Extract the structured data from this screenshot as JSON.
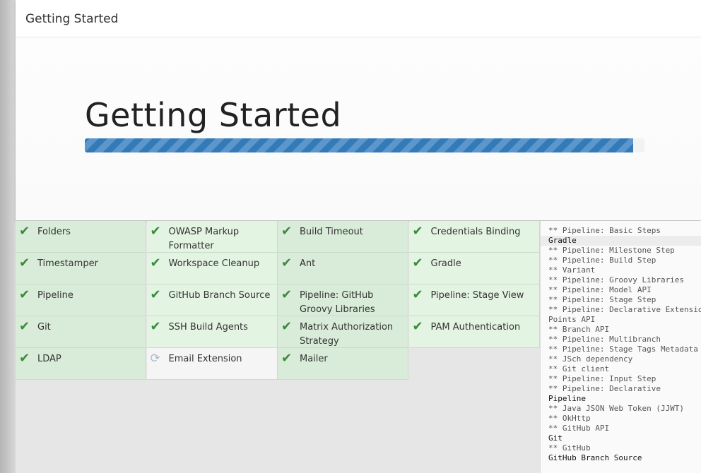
{
  "window": {
    "title": "Getting Started"
  },
  "hero": {
    "title": "Getting Started",
    "progress_percent": 98
  },
  "plugins": [
    {
      "label": "Folders",
      "status": "done"
    },
    {
      "label": "OWASP Markup Formatter",
      "status": "done"
    },
    {
      "label": "Build Timeout",
      "status": "done"
    },
    {
      "label": "Credentials Binding",
      "status": "done"
    },
    {
      "label": "Timestamper",
      "status": "done"
    },
    {
      "label": "Workspace Cleanup",
      "status": "done"
    },
    {
      "label": "Ant",
      "status": "done"
    },
    {
      "label": "Gradle",
      "status": "done"
    },
    {
      "label": "Pipeline",
      "status": "done"
    },
    {
      "label": "GitHub Branch Source",
      "status": "done"
    },
    {
      "label": "Pipeline: GitHub Groovy Libraries",
      "status": "done"
    },
    {
      "label": "Pipeline: Stage View",
      "status": "done"
    },
    {
      "label": "Git",
      "status": "done"
    },
    {
      "label": "SSH Build Agents",
      "status": "done"
    },
    {
      "label": "Matrix Authorization Strategy",
      "status": "done"
    },
    {
      "label": "PAM Authentication",
      "status": "done"
    },
    {
      "label": "LDAP",
      "status": "done"
    },
    {
      "label": "Email Extension",
      "status": "pending"
    },
    {
      "label": "Mailer",
      "status": "done"
    }
  ],
  "icons": {
    "done": "checkmark-icon",
    "pending": "spinner-icon"
  },
  "colors": {
    "accent": "#337ab7",
    "done_bg": "#d9ecd9",
    "check": "#3c8a3c"
  },
  "log": [
    "** Pipeline: Basic Steps",
    "Gradle",
    "** Pipeline: Milestone Step",
    "** Pipeline: Build Step",
    "** Variant",
    "** Pipeline: Groovy Libraries",
    "** Pipeline: Model API",
    "** Pipeline: Stage Step",
    "** Pipeline: Declarative Extension",
    "Points API",
    "** Branch API",
    "** Pipeline: Multibranch",
    "** Pipeline: Stage Tags Metadata",
    "** JSch dependency",
    "** Git client",
    "** Pipeline: Input Step",
    "** Pipeline: Declarative",
    "Pipeline",
    "** Java JSON Web Token (JJWT)",
    "** OkHttp",
    "** GitHub API",
    "Git",
    "** GitHub",
    "GitHub Branch Source"
  ]
}
